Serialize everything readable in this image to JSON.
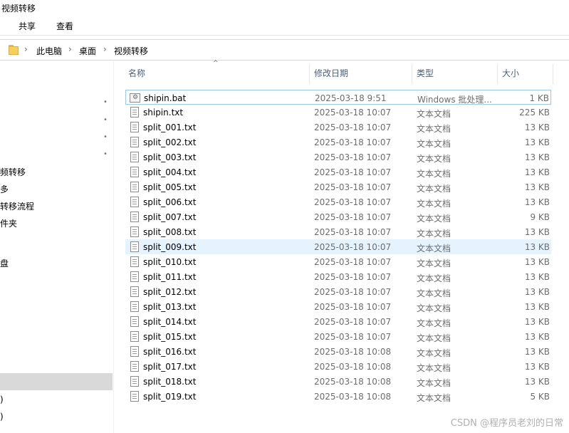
{
  "window": {
    "title": "视频转移"
  },
  "ribbon": {
    "tabs": [
      "共享",
      "查看"
    ]
  },
  "address": {
    "crumbs": [
      "此电脑",
      "桌面",
      "视频转移"
    ]
  },
  "nav": {
    "items": [
      "频转移",
      "多",
      "转移流程",
      "件夹",
      "盘",
      ")",
      ")"
    ]
  },
  "columns": {
    "name": "名称",
    "date": "修改日期",
    "type": "类型",
    "size": "大小"
  },
  "files": [
    {
      "name": "shipin.bat",
      "date": "2025-03-18 9:51",
      "type": "Windows 批处理...",
      "size": "1 KB",
      "icon": "batch-file-icon"
    },
    {
      "name": "shipin.txt",
      "date": "2025-03-18 10:07",
      "type": "文本文档",
      "size": "225 KB",
      "icon": "text-file-icon"
    },
    {
      "name": "split_001.txt",
      "date": "2025-03-18 10:07",
      "type": "文本文档",
      "size": "13 KB",
      "icon": "text-file-icon"
    },
    {
      "name": "split_002.txt",
      "date": "2025-03-18 10:07",
      "type": "文本文档",
      "size": "13 KB",
      "icon": "text-file-icon"
    },
    {
      "name": "split_003.txt",
      "date": "2025-03-18 10:07",
      "type": "文本文档",
      "size": "13 KB",
      "icon": "text-file-icon"
    },
    {
      "name": "split_004.txt",
      "date": "2025-03-18 10:07",
      "type": "文本文档",
      "size": "13 KB",
      "icon": "text-file-icon"
    },
    {
      "name": "split_005.txt",
      "date": "2025-03-18 10:07",
      "type": "文本文档",
      "size": "13 KB",
      "icon": "text-file-icon"
    },
    {
      "name": "split_006.txt",
      "date": "2025-03-18 10:07",
      "type": "文本文档",
      "size": "13 KB",
      "icon": "text-file-icon"
    },
    {
      "name": "split_007.txt",
      "date": "2025-03-18 10:07",
      "type": "文本文档",
      "size": "9 KB",
      "icon": "text-file-icon"
    },
    {
      "name": "split_008.txt",
      "date": "2025-03-18 10:07",
      "type": "文本文档",
      "size": "13 KB",
      "icon": "text-file-icon"
    },
    {
      "name": "split_009.txt",
      "date": "2025-03-18 10:07",
      "type": "文本文档",
      "size": "13 KB",
      "icon": "text-file-icon"
    },
    {
      "name": "split_010.txt",
      "date": "2025-03-18 10:07",
      "type": "文本文档",
      "size": "13 KB",
      "icon": "text-file-icon"
    },
    {
      "name": "split_011.txt",
      "date": "2025-03-18 10:07",
      "type": "文本文档",
      "size": "13 KB",
      "icon": "text-file-icon"
    },
    {
      "name": "split_012.txt",
      "date": "2025-03-18 10:07",
      "type": "文本文档",
      "size": "13 KB",
      "icon": "text-file-icon"
    },
    {
      "name": "split_013.txt",
      "date": "2025-03-18 10:07",
      "type": "文本文档",
      "size": "13 KB",
      "icon": "text-file-icon"
    },
    {
      "name": "split_014.txt",
      "date": "2025-03-18 10:07",
      "type": "文本文档",
      "size": "13 KB",
      "icon": "text-file-icon"
    },
    {
      "name": "split_015.txt",
      "date": "2025-03-18 10:07",
      "type": "文本文档",
      "size": "13 KB",
      "icon": "text-file-icon"
    },
    {
      "name": "split_016.txt",
      "date": "2025-03-18 10:08",
      "type": "文本文档",
      "size": "13 KB",
      "icon": "text-file-icon"
    },
    {
      "name": "split_017.txt",
      "date": "2025-03-18 10:08",
      "type": "文本文档",
      "size": "13 KB",
      "icon": "text-file-icon"
    },
    {
      "name": "split_018.txt",
      "date": "2025-03-18 10:08",
      "type": "文本文档",
      "size": "13 KB",
      "icon": "text-file-icon"
    },
    {
      "name": "split_019.txt",
      "date": "2025-03-18 10:08",
      "type": "文本文档",
      "size": "5 KB",
      "icon": "text-file-icon"
    }
  ],
  "watermark": "CSDN @程序员老刘的日常"
}
